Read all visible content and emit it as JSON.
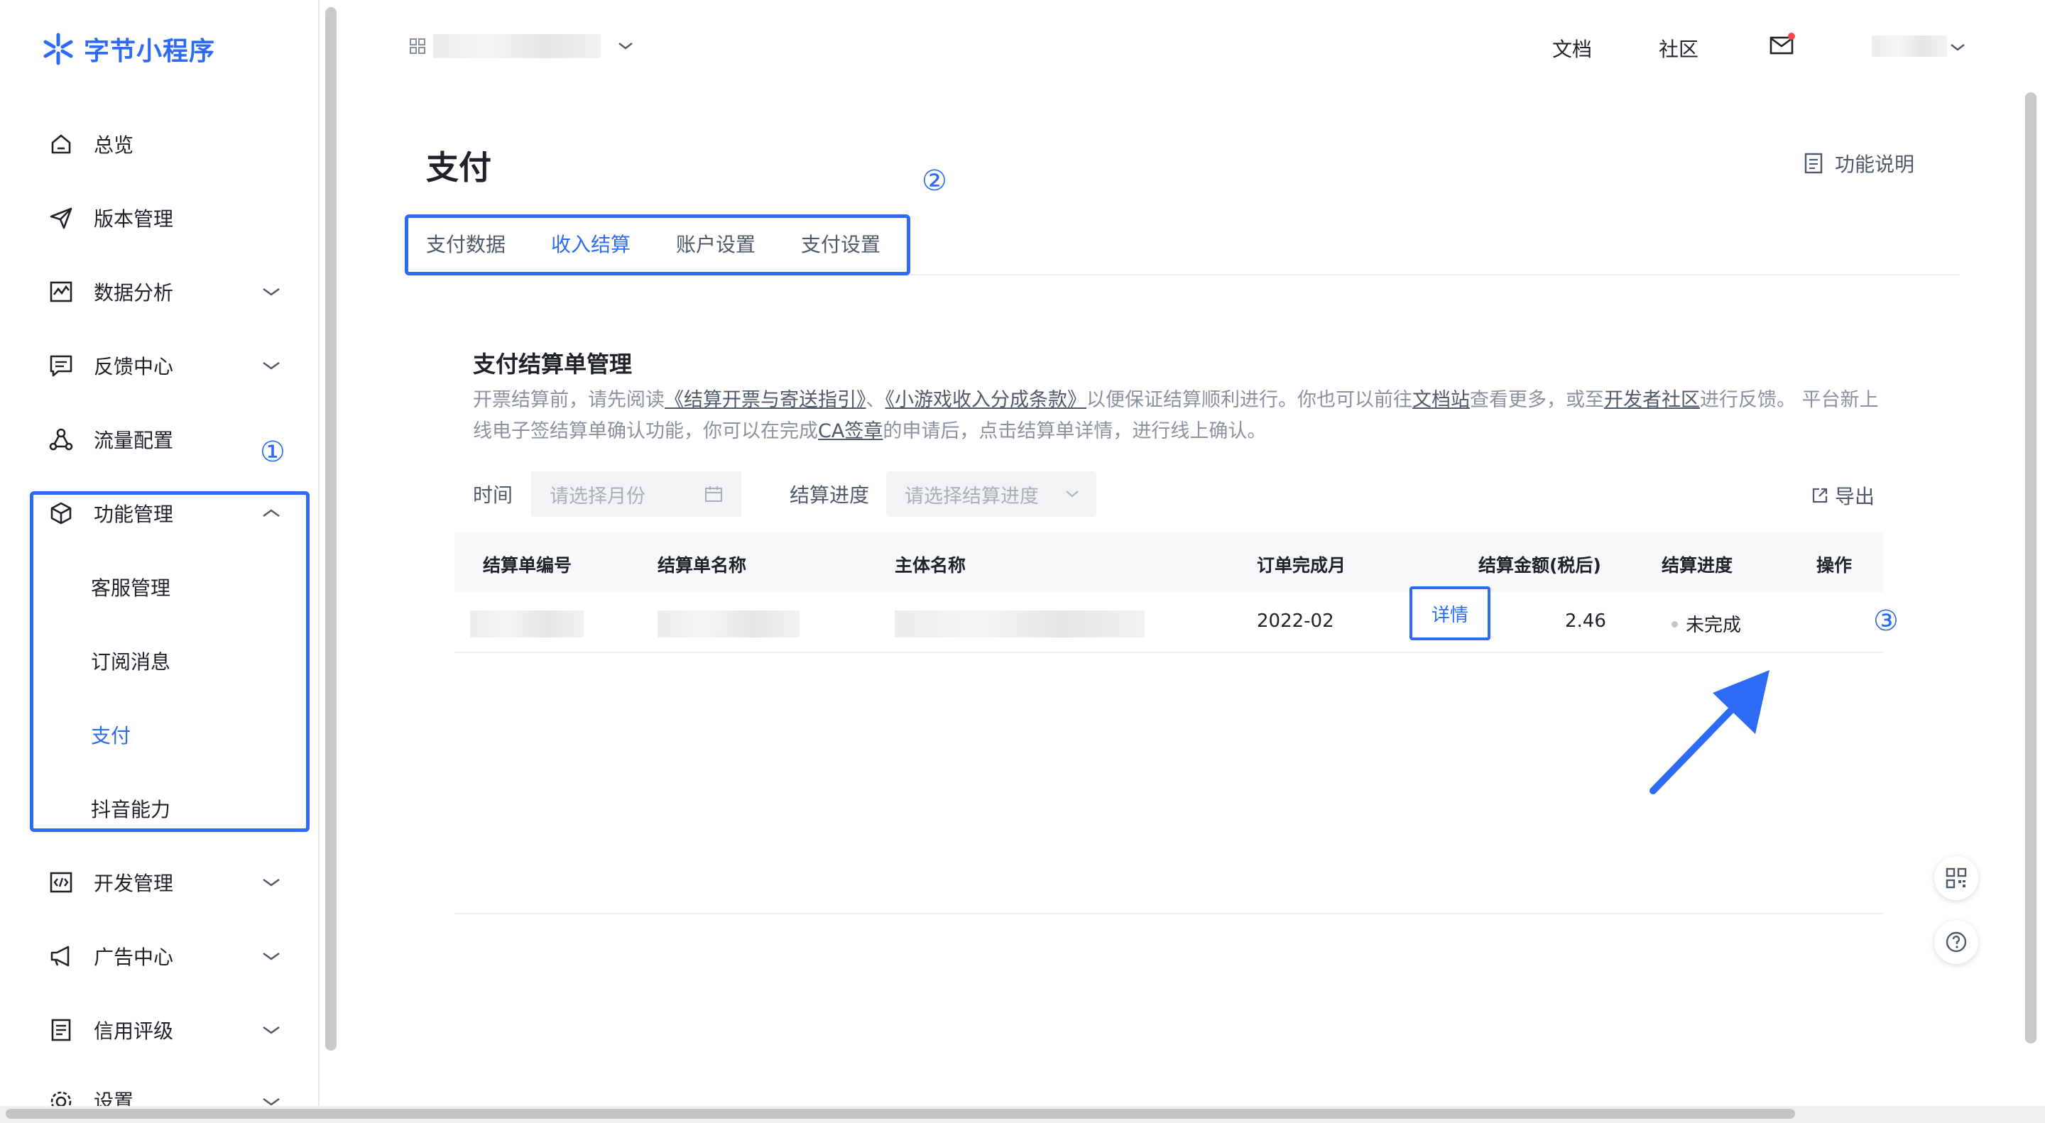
{
  "app": {
    "logo_text": "字节小程序"
  },
  "sidebar": {
    "items": [
      {
        "label": "总览",
        "icon": "home-icon"
      },
      {
        "label": "版本管理",
        "icon": "send-icon"
      },
      {
        "label": "数据分析",
        "icon": "chart-icon"
      },
      {
        "label": "反馈中心",
        "icon": "message-icon"
      },
      {
        "label": "流量配置",
        "icon": "share-icon"
      },
      {
        "label": "功能管理",
        "icon": "box-icon"
      },
      {
        "label": "开发管理",
        "icon": "code-icon"
      },
      {
        "label": "广告中心",
        "icon": "megaphone-icon"
      },
      {
        "label": "信用评级",
        "icon": "document-icon"
      },
      {
        "label": "设置",
        "icon": "gear-icon"
      }
    ],
    "sub_items": [
      "客服管理",
      "订阅消息",
      "支付",
      "抖音能力"
    ],
    "active_sub": "支付"
  },
  "topbar": {
    "docs": "文档",
    "community": "社区"
  },
  "page": {
    "title": "支付",
    "func_doc": "功能说明",
    "tabs": [
      "支付数据",
      "收入结算",
      "账户设置",
      "支付设置"
    ],
    "active_tab": "收入结算"
  },
  "card": {
    "title": "支付结算单管理",
    "desc": {
      "p1": "开票结算前，请先阅读",
      "link1": "《结算开票与寄送指引》",
      "p2": "、",
      "link2": "《小游戏收入分成条款》",
      "p3": "以便保证结算顺利进行。你也可以前往",
      "link3": "文档站",
      "p4": "查看更多，或至",
      "link4": "开发者社区",
      "p5": "进行反馈。 平台新上线电子签结算单确认功能，你可以在完成",
      "link5": "CA签章",
      "p6": "的申请后，点击结算单详情，进行线上确认。"
    }
  },
  "filters": {
    "time_label": "时间",
    "time_placeholder": "请选择月份",
    "progress_label": "结算进度",
    "progress_placeholder": "请选择结算进度",
    "export": "导出"
  },
  "table": {
    "headers": [
      "结算单编号",
      "结算单名称",
      "主体名称",
      "订单完成月",
      "结算金额(税后)",
      "结算进度",
      "操作"
    ],
    "rows": [
      {
        "month": "2022-02",
        "amount": "2.46",
        "status": "未完成",
        "action": "详情"
      }
    ]
  },
  "annotations": {
    "num1": "①",
    "num2": "②",
    "num3": "③"
  },
  "colors": {
    "accent": "#2e6bf5",
    "text": "#1f2329",
    "muted": "#8a919f"
  }
}
